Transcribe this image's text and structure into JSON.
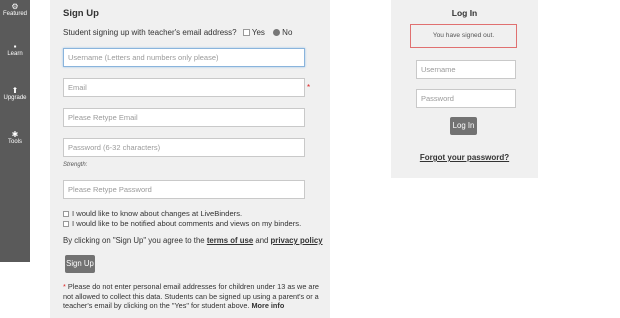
{
  "sidebar": {
    "items": [
      {
        "label": "Featured",
        "icon": "gear-icon",
        "glyph": "⚙"
      },
      {
        "label": "Learn",
        "icon": "lightbulb-icon",
        "glyph": "💡"
      },
      {
        "label": "Upgrade",
        "icon": "arrow-up-icon",
        "glyph": "⬆"
      },
      {
        "label": "Tools",
        "icon": "tools-icon",
        "glyph": "✱"
      }
    ]
  },
  "signup": {
    "title": "Sign Up",
    "teacher_question": "Student signing up with teacher's email address?",
    "yes_label": "Yes",
    "no_label": "No",
    "selected_option": "No",
    "username_placeholder": "Username (Letters and numbers only please)",
    "email_placeholder": "Email",
    "required_marker": "*",
    "retype_email_placeholder": "Please Retype Email",
    "password_placeholder": "Password (6-32 characters)",
    "strength_label": "Strength:",
    "retype_password_placeholder": "Please Retype Password",
    "opt_changes_label": "I would like to know about changes at LiveBinders.",
    "opt_notify_label": "I would like to be notified about comments and views on my binders.",
    "terms_prefix": "By clicking on \"Sign Up\" you agree to the",
    "terms_link": "terms of use",
    "terms_and": "and",
    "privacy_link": "privacy policy",
    "submit_label": "Sign Up",
    "note_star": "*",
    "note_text": "Please do not enter personal email addresses for children under 13 as we are not allowed to collect this data. Students can be signed up using a parent's or a teacher's email by clicking on the \"Yes\" for student above.",
    "more_info": "More info"
  },
  "login": {
    "title": "Log In",
    "status_message": "You have signed out.",
    "username_placeholder": "Username",
    "password_placeholder": "Password",
    "submit_label": "Log In",
    "forgot_link": "Forgot your password?"
  },
  "colors": {
    "sidebar_bg": "#5a5a5a",
    "panel_bg": "#f0f0f0",
    "button_bg": "#727272",
    "required_red": "#dd2222",
    "status_border": "#e07070"
  }
}
